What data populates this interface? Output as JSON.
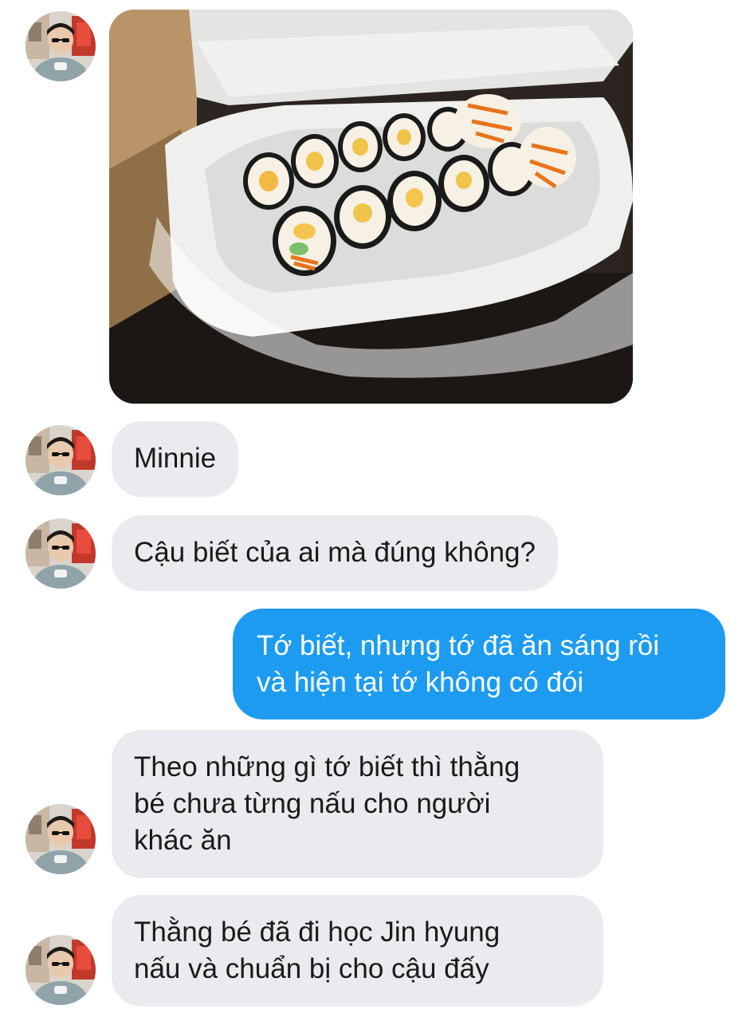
{
  "colors": {
    "incoming_bubble": "#e9ebee",
    "outgoing_bubble": "#1d9bf0",
    "incoming_text": "#1a1a1a",
    "outgoing_text": "#ffffff"
  },
  "messages": [
    {
      "type": "image",
      "sender": "other",
      "image_alt": "kimbap rolls in a foam takeout box"
    },
    {
      "type": "text",
      "sender": "other",
      "lines": [
        "Minnie"
      ]
    },
    {
      "type": "text",
      "sender": "other",
      "lines": [
        "Cậu biết của ai mà đúng không?"
      ]
    },
    {
      "type": "text",
      "sender": "me",
      "lines": [
        "Tớ biết, nhưng tớ đã ăn sáng rồi",
        "và hiện tại tớ không có đói"
      ]
    },
    {
      "type": "text",
      "sender": "other",
      "lines": [
        "Theo những gì tớ biết thì thằng",
        "bé chưa từng nấu cho người",
        "khác ăn"
      ]
    },
    {
      "type": "text",
      "sender": "other",
      "lines": [
        "Thằng bé đã đi học Jin hyung",
        "nấu và chuẩn bị cho cậu đấy"
      ]
    }
  ]
}
